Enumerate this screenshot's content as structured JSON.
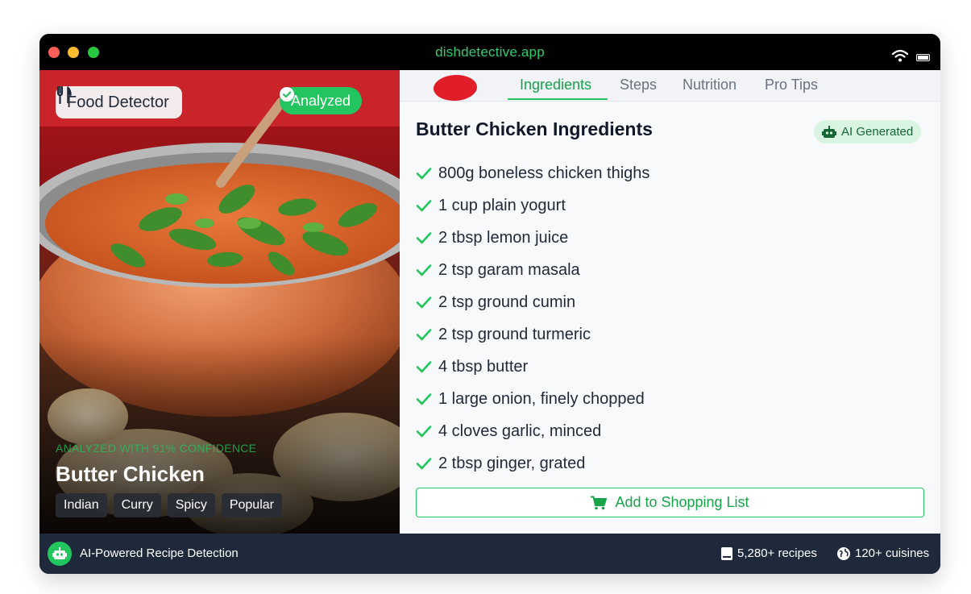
{
  "window": {
    "url": "dishdetective.app"
  },
  "hero": {
    "food_badge": "Food Detector",
    "status_badge": "Analyzed",
    "confidence": "ANALYZED WITH 91% CONFIDENCE",
    "dish_name": "Butter Chicken",
    "tags": [
      "Indian",
      "Curry",
      "Spicy",
      "Popular"
    ]
  },
  "tabs": [
    "Ingredients",
    "Steps",
    "Nutrition",
    "Pro Tips"
  ],
  "active_tab": "Ingredients",
  "panel": {
    "title": "Butter Chicken Ingredients",
    "ai_chip": "AI Generated",
    "ingredients": [
      "800g boneless chicken thighs",
      "1 cup plain yogurt",
      "2 tbsp lemon juice",
      "2 tsp garam masala",
      "2 tsp ground cumin",
      "2 tsp ground turmeric",
      "4 tbsp butter",
      "1 large onion, finely chopped",
      "4 cloves garlic, minced",
      "2 tbsp ginger, grated"
    ],
    "shopping_button": "Add to Shopping List"
  },
  "footer": {
    "tagline": "AI-Powered Recipe Detection",
    "recipes": "5,280+ recipes",
    "cuisines": "120+ cuisines"
  },
  "colors": {
    "accent": "#22c55e",
    "footer_bg": "#1e293b",
    "titlebar": "#000000"
  },
  "icons": [
    "utensils-icon",
    "check-circle-icon",
    "robot-icon",
    "check-icon",
    "cart-icon",
    "book-icon",
    "globe-icon",
    "wifi-icon",
    "battery-icon"
  ]
}
